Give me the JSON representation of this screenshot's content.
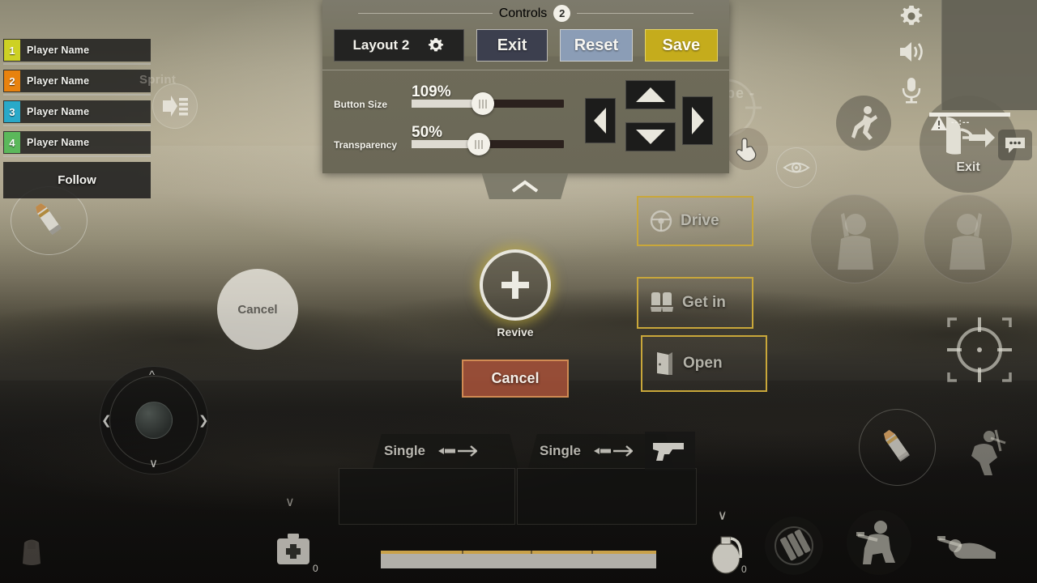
{
  "controls_panel": {
    "title": "Controls",
    "badge": "2",
    "layout_label": "Layout 2",
    "layout_gear_icon": "gear-icon",
    "exit_label": "Exit",
    "reset_label": "Reset",
    "save_label": "Save",
    "sliders": [
      {
        "label": "Button Size",
        "value": "109%",
        "percent": 47
      },
      {
        "label": "Transparency",
        "value": "50%",
        "percent": 44
      }
    ],
    "dpad": {
      "left_icon": "triangle-left-icon",
      "up_icon": "triangle-up-icon",
      "down_icon": "triangle-down-icon",
      "right_icon": "triangle-right-icon"
    },
    "collapse_icon": "chevron-up-icon",
    "colors": {
      "panel_bg": "#76735f",
      "exit": "#3c3f4e",
      "reset": "#8b9db6",
      "save": "#c5ac1c",
      "layout": "#232322"
    }
  },
  "team": {
    "members": [
      {
        "num": "1",
        "name": "Player Name",
        "color": "#cdd124"
      },
      {
        "num": "2",
        "name": "Player Name",
        "color": "#e8820e"
      },
      {
        "num": "3",
        "name": "Player Name",
        "color": "#29a9c9"
      },
      {
        "num": "4",
        "name": "Player Name",
        "color": "#5bb85b"
      }
    ],
    "follow_label": "Follow"
  },
  "hud": {
    "sprint_label": "Sprint",
    "sprint_icon": "sprint-icon",
    "scope_label": "- Scope -",
    "cancel_circle_label": "Cancel",
    "revive_label": "Revive",
    "revive_icon": "plus-icon",
    "cancel_button_label": "Cancel",
    "exit_vehicle_label": "Exit",
    "warning_time": "--:--",
    "warning_icon": "warning-icon",
    "crate_count": "0",
    "grenade_count": "0",
    "med_count": "0",
    "interactions": [
      {
        "label": "Drive",
        "icon": "steering-wheel-icon"
      },
      {
        "label": "Get in",
        "icon": "car-seat-icon"
      },
      {
        "label": "Open",
        "icon": "door-icon"
      }
    ],
    "icons": {
      "settings": "gear-icon",
      "speaker": "speaker-icon",
      "mic": "microphone-icon",
      "run": "running-man-icon",
      "eye": "eye-icon",
      "exit_vehicle": "exit-vehicle-icon",
      "chat": "chat-bubble-icon",
      "peek_left": "peek-left-icon",
      "peek_right": "peek-right-icon",
      "crosshair": "crosshair-icon",
      "ammo": "bullet-icon",
      "vault": "vault-icon",
      "grenade": "grenade-icon",
      "reload": "reload-ammo-icon",
      "crouch": "crouch-icon",
      "prone": "prone-icon",
      "medkit": "medkit-icon",
      "backpack": "backpack-icon",
      "hand": "hand-tap-icon"
    }
  },
  "weapons": [
    {
      "mode": "Single",
      "mode_icon": "bullet-arrow-icon"
    },
    {
      "mode": "Single",
      "mode_icon": "bullet-arrow-icon"
    },
    {
      "mode": "",
      "mode_icon": "pistol-icon"
    }
  ]
}
